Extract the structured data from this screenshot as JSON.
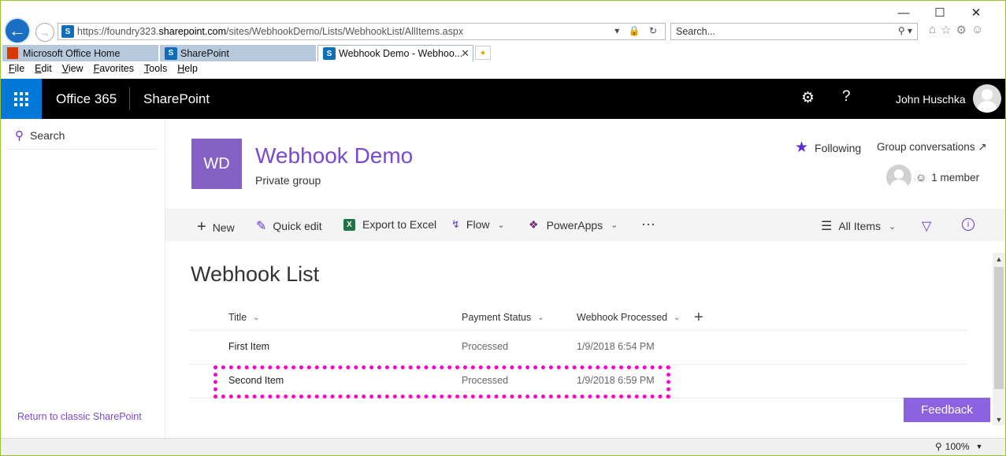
{
  "browser": {
    "url_prefix": "https://foundry323.",
    "url_host": "sharepoint.com",
    "url_path": "/sites/WebhookDemo/Lists/WebhookList/AllItems.aspx",
    "search_placeholder": "Search...",
    "tabs": [
      {
        "label": "Microsoft Office Home"
      },
      {
        "label": "SharePoint"
      },
      {
        "label": "Webhook Demo - Webhoo..."
      }
    ],
    "menu": [
      "File",
      "Edit",
      "View",
      "Favorites",
      "Tools",
      "Help"
    ],
    "zoom": "100%"
  },
  "suitebar": {
    "app": "Office 365",
    "product": "SharePoint",
    "help_glyph": "?",
    "user_name": "John Huschka"
  },
  "leftnav": {
    "search_label": "Search",
    "classic_link": "Return to classic SharePoint"
  },
  "site": {
    "logo_initials": "WD",
    "title": "Webhook Demo",
    "subtitle": "Private group",
    "following_label": "Following",
    "group_conversations": "Group conversations",
    "members": "1 member"
  },
  "commands": {
    "new": "New",
    "quick_edit": "Quick edit",
    "export": "Export to Excel",
    "flow": "Flow",
    "powerapps": "PowerApps",
    "more": "···",
    "view": "All Items"
  },
  "list": {
    "title": "Webhook List",
    "columns": [
      "Title",
      "Payment Status",
      "Webhook Processed"
    ],
    "rows": [
      {
        "title": "First Item",
        "status": "Processed",
        "processed": "1/9/2018 6:54 PM"
      },
      {
        "title": "Second Item",
        "status": "Processed",
        "processed": "1/9/2018 6:59 PM"
      }
    ]
  },
  "feedback_label": "Feedback",
  "colors": {
    "accent": "#7a48d6",
    "suitebar": "#000000",
    "waffle": "#0078d7",
    "highlight": "#ff00cc",
    "feedback": "#8c62e0"
  }
}
